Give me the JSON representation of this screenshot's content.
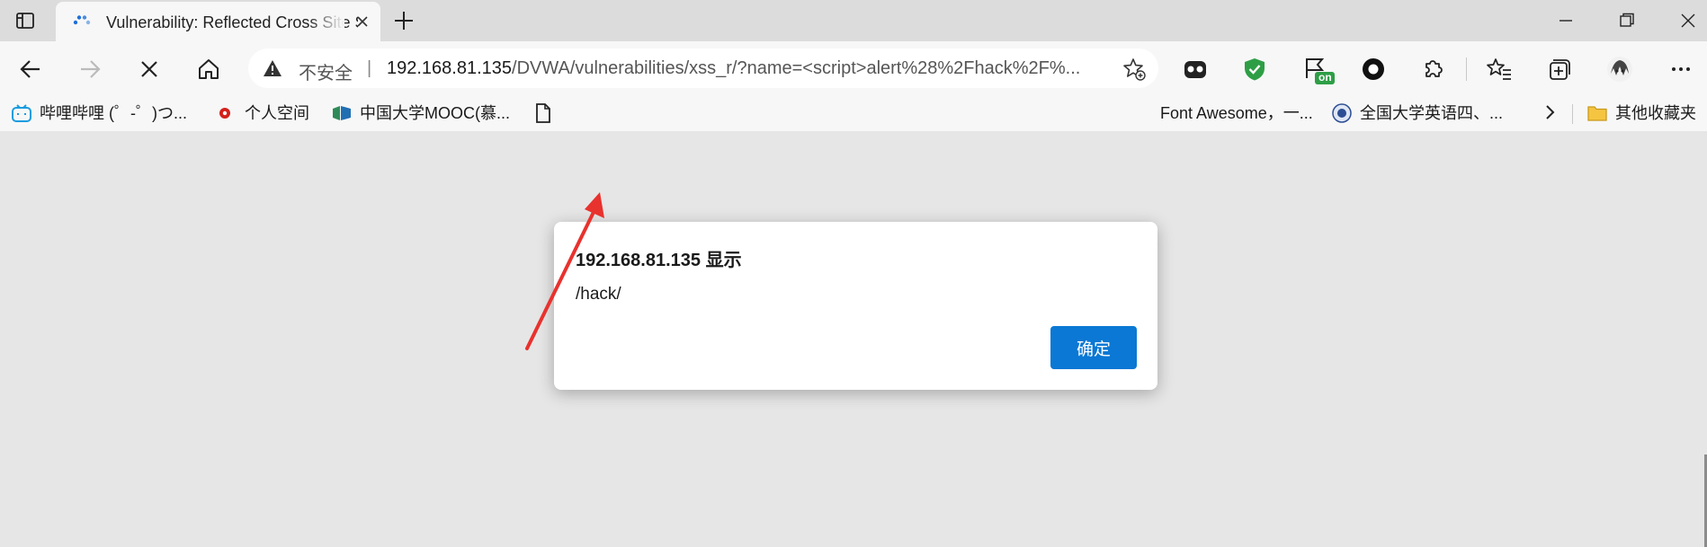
{
  "tab": {
    "title": "Vulnerability: Reflected Cross Site Scripting (XSS)"
  },
  "address_bar": {
    "security_label": "不安全",
    "separator": "|",
    "url_host": "192.168.81.135",
    "url_rest": "/DVWA/vulnerabilities/xss_r/?name=<script>alert%28%2Fhack%2F%..."
  },
  "extensions": {
    "on_badge": "on"
  },
  "bookmarks": [
    {
      "label": "哔哩哔哩 (゜-゜)つ...",
      "icon": "bilibili-icon"
    },
    {
      "label": "个人空间",
      "icon": "personal-space-icon"
    },
    {
      "label": "中国大学MOOC(慕...",
      "icon": "mooc-icon"
    },
    {
      "label": "",
      "icon": "document-icon"
    },
    {
      "label": "Font Awesome，一...",
      "icon": "font-awesome-icon"
    },
    {
      "label": "全国大学英语四、...",
      "icon": "cet-icon"
    },
    {
      "label": "其他收藏夹",
      "icon": "folder-icon"
    }
  ],
  "dialog": {
    "heading": "192.168.81.135 显示",
    "message": "/hack/",
    "ok_label": "确定"
  },
  "colors": {
    "accent": "#0a78d4",
    "annotation_arrow": "#e8322e",
    "ext_green": "#2e9e46",
    "page_bg": "#e6e6e6"
  }
}
